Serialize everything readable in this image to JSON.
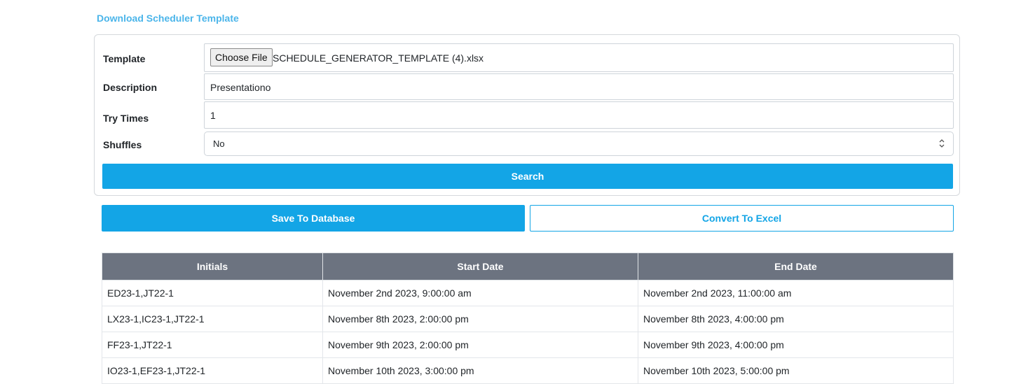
{
  "download_link": "Download Scheduler Template",
  "form": {
    "template_label": "Template",
    "choose_file_label": "Choose File",
    "file_name": "SCHEDULE_GENERATOR_TEMPLATE (4).xlsx",
    "description_label": "Description",
    "description_value": "Presentationo",
    "try_times_label": "Try Times",
    "try_times_value": "1",
    "shuffles_label": "Shuffles",
    "shuffles_value": "No",
    "search_label": "Search"
  },
  "actions": {
    "save_label": "Save To Database",
    "excel_label": "Convert To Excel"
  },
  "table": {
    "headers": [
      "Initials",
      "Start Date",
      "End Date"
    ],
    "rows": [
      [
        "ED23-1,JT22-1",
        "November 2nd 2023, 9:00:00 am",
        "November 2nd 2023, 11:00:00 am"
      ],
      [
        "LX23-1,IC23-1,JT22-1",
        "November 8th 2023, 2:00:00 pm",
        "November 8th 2023, 4:00:00 pm"
      ],
      [
        "FF23-1,JT22-1",
        "November 9th 2023, 2:00:00 pm",
        "November 9th 2023, 4:00:00 pm"
      ],
      [
        "IO23-1,EF23-1,JT22-1",
        "November 10th 2023, 3:00:00 pm",
        "November 10th 2023, 5:00:00 pm"
      ]
    ]
  },
  "colors": {
    "accent": "#13a5e6",
    "link": "#4bb5ea",
    "table_header": "#6c7380"
  },
  "icons": {
    "select_chevron": "chevron-up-down-icon"
  }
}
